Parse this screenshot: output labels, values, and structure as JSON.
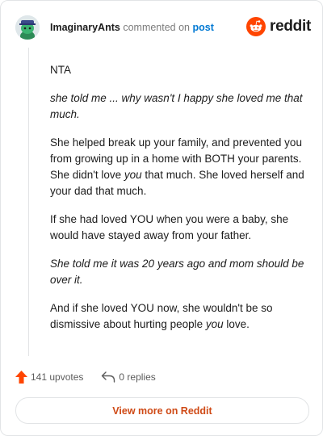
{
  "header": {
    "username": "ImaginaryAnts",
    "commented_on": "commented on",
    "post_link": "post",
    "brand": "reddit"
  },
  "comment": {
    "p1": "NTA",
    "p2": "she told me ... why wasn't I happy she loved me that much.",
    "p3_a": "She helped break up your family, and prevented you from growing up in a home with BOTH your parents. She didn't love ",
    "p3_em": "you",
    "p3_b": " that much. She loved herself and your dad that much.",
    "p4": "If she had loved YOU when you were a baby, she would have stayed away from your father.",
    "p5": "She told me it was 20 years ago and mom should be over it.",
    "p6_a": "And if she loved YOU now, she wouldn't be so dismissive about hurting people ",
    "p6_em": "you",
    "p6_b": " love."
  },
  "actions": {
    "upvotes": "141 upvotes",
    "replies": "0 replies"
  },
  "footer": {
    "view_more": "View more on Reddit"
  },
  "colors": {
    "upvote": "#ff4500",
    "link": "#0079d3",
    "brand": "#ff4500",
    "view_more": "#cf4a16"
  }
}
